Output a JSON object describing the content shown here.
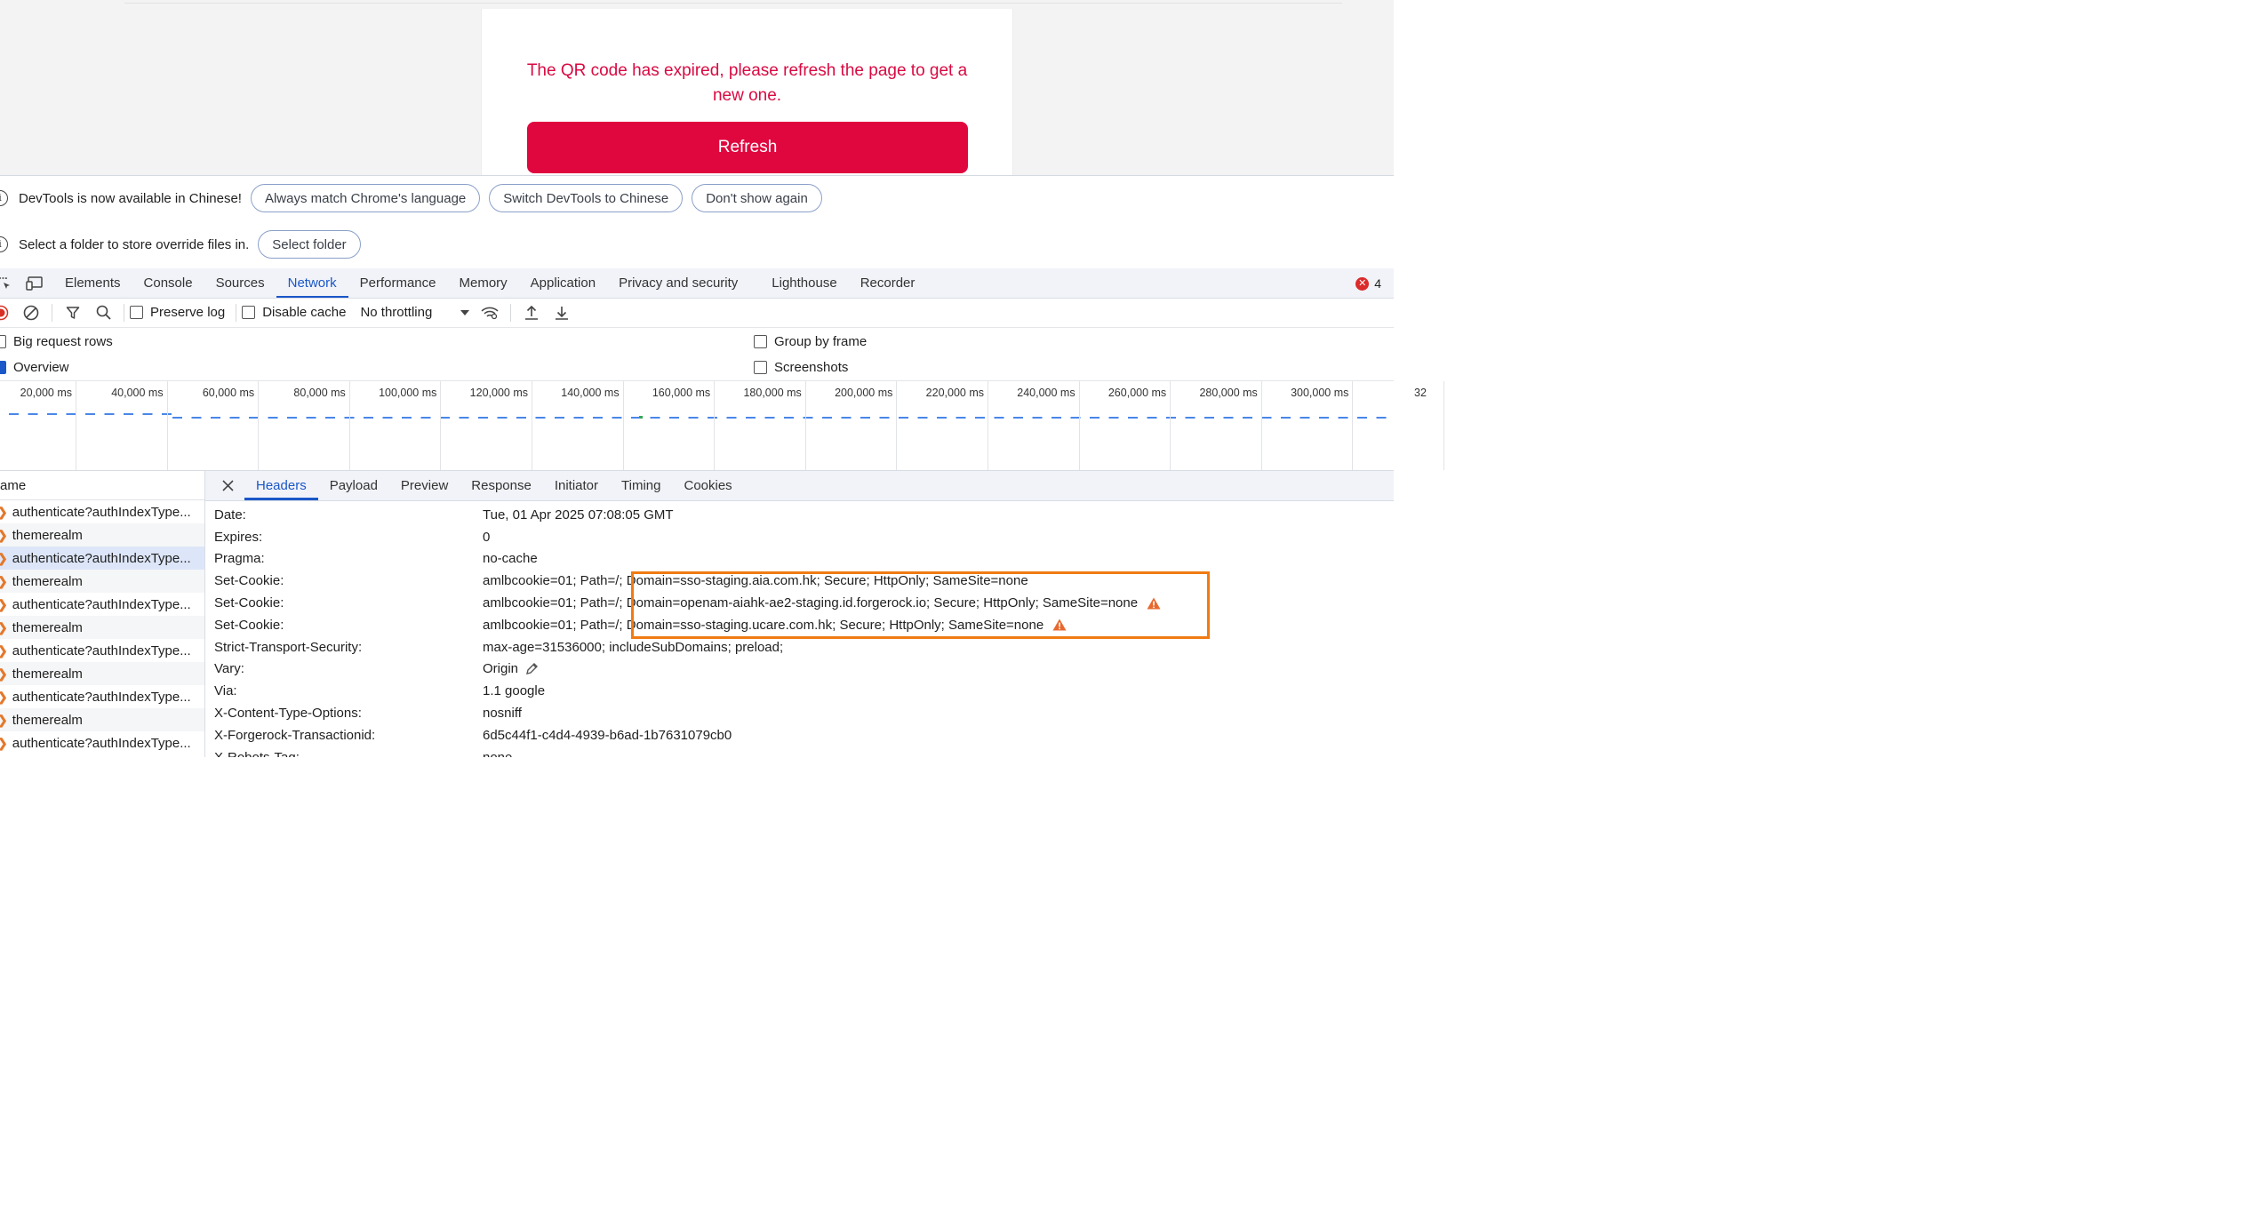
{
  "page": {
    "qr_message": "The QR code has expired, please refresh the page to get a new one.",
    "refresh_label": "Refresh"
  },
  "infobar_language": {
    "text": "DevTools is now available in Chinese!",
    "btn_match": "Always match Chrome's language",
    "btn_switch": "Switch DevTools to Chinese",
    "btn_dismiss": "Don't show again"
  },
  "infobar_overrides": {
    "text": "Select a folder to store override files in.",
    "btn_select": "Select folder"
  },
  "panel_tabs": [
    "Elements",
    "Console",
    "Sources",
    "Network",
    "Performance",
    "Memory",
    "Application",
    "Privacy and security",
    "Lighthouse",
    "Recorder"
  ],
  "active_panel": "Network",
  "error_count": "4",
  "toolbar": {
    "preserve_log": "Preserve log",
    "disable_cache": "Disable cache",
    "throttling": "No throttling"
  },
  "settings": {
    "big_rows": "Big request rows",
    "overview": "Overview",
    "group_by_frame": "Group by frame",
    "screenshots": "Screenshots"
  },
  "timeline_ticks": [
    "20,000 ms",
    "40,000 ms",
    "60,000 ms",
    "80,000 ms",
    "100,000 ms",
    "120,000 ms",
    "140,000 ms",
    "160,000 ms",
    "180,000 ms",
    "200,000 ms",
    "220,000 ms",
    "240,000 ms",
    "260,000 ms",
    "280,000 ms",
    "300,000 ms",
    "32"
  ],
  "request_list": {
    "header": "ame",
    "rows": [
      "authenticate?authIndexType...",
      "themerealm",
      "authenticate?authIndexType...",
      "themerealm",
      "authenticate?authIndexType...",
      "themerealm",
      "authenticate?authIndexType...",
      "themerealm",
      "authenticate?authIndexType...",
      "themerealm",
      "authenticate?authIndexType..."
    ],
    "selected_index": 2
  },
  "detail_tabs": [
    "Headers",
    "Payload",
    "Preview",
    "Response",
    "Initiator",
    "Timing",
    "Cookies"
  ],
  "active_detail_tab": "Headers",
  "headers": [
    {
      "name": "Date:",
      "value": "Tue, 01 Apr 2025 07:08:05 GMT"
    },
    {
      "name": "Expires:",
      "value": "0"
    },
    {
      "name": "Pragma:",
      "value": "no-cache"
    },
    {
      "name": "Set-Cookie:",
      "value": "amlbcookie=01; Path=/; Domain=sso-staging.aia.com.hk; Secure; HttpOnly; SameSite=none"
    },
    {
      "name": "Set-Cookie:",
      "value": "amlbcookie=01; Path=/; Domain=openam-aiahk-ae2-staging.id.forgerock.io; Secure; HttpOnly; SameSite=none",
      "warning": true
    },
    {
      "name": "Set-Cookie:",
      "value": "amlbcookie=01; Path=/; Domain=sso-staging.ucare.com.hk; Secure; HttpOnly; SameSite=none",
      "warning": true
    },
    {
      "name": "Strict-Transport-Security:",
      "value": "max-age=31536000; includeSubDomains; preload;"
    },
    {
      "name": "Vary:",
      "value": "Origin",
      "editable": true
    },
    {
      "name": "Via:",
      "value": "1.1 google"
    },
    {
      "name": "X-Content-Type-Options:",
      "value": "nosniff"
    },
    {
      "name": "X-Forgerock-Transactionid:",
      "value": "6d5c44f1-c4d4-4939-b6ad-1b7631079cb0"
    },
    {
      "name": "X-Robots-Tag:",
      "value": "none"
    }
  ],
  "colors": {
    "brand_red": "#e0073f",
    "devtools_blue": "#1a57c9",
    "highlight_orange": "#f07b12",
    "warning_orange": "#e8682d"
  }
}
